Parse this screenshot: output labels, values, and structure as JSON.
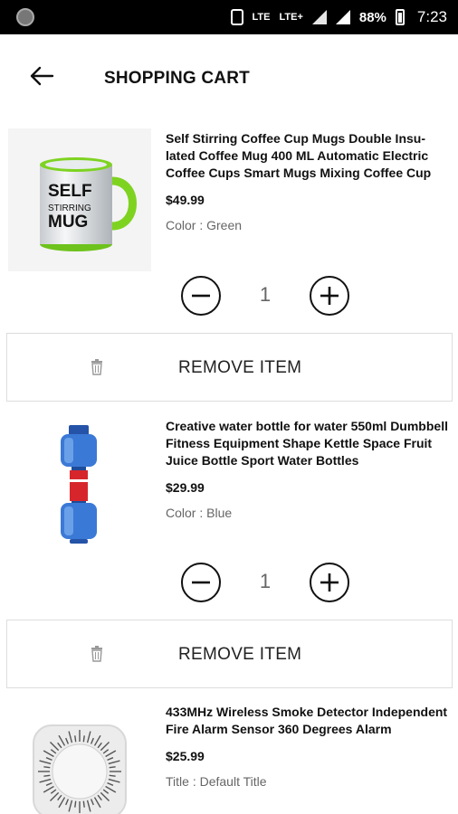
{
  "status_bar": {
    "network_labels": [
      "LTE",
      "LTE+"
    ],
    "battery": "88%",
    "time": "7:23"
  },
  "header": {
    "title": "SHOPPING CART",
    "back_icon": "arrow-left-icon"
  },
  "cart_items": [
    {
      "name": "Self Stirring Coffee Cup Mugs Double Insu-lated Coffee Mug 400 ML Automatic Electric Coffee Cups Smart Mugs Mixing Coffee Cup",
      "price": "$49.99",
      "variant": "Color : Green",
      "image_text": [
        "SELF",
        "STIRRING",
        "MUG"
      ],
      "quantity": "1",
      "remove_label": "REMOVE ITEM",
      "accent_color": "#7ed321"
    },
    {
      "name": "Creative water bottle for water 550ml Dumbbell Fitness Equipment Shape Kettle Space Fruit Juice Bottle Sport Water Bottles",
      "price": "$29.99",
      "variant": "Color : Blue",
      "quantity": "1",
      "remove_label": "REMOVE ITEM",
      "accent_color": "#2f6fd1"
    },
    {
      "name": "433MHz Wireless Smoke Detector Independent Fire Alarm Sensor 360 Degrees Alarm",
      "price": "$25.99",
      "variant": "Title : Default Title"
    }
  ]
}
